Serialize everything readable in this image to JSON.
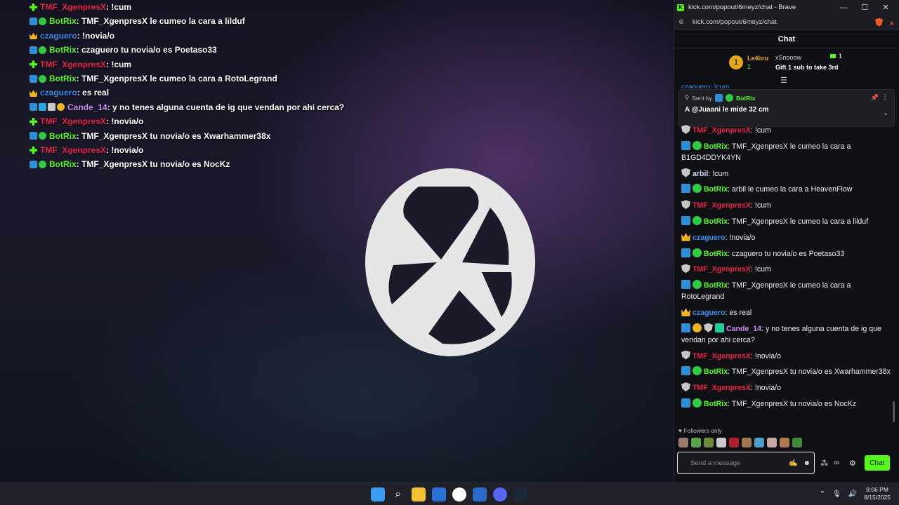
{
  "stream": {
    "overlay_chat": [
      {
        "badges": [
          "plus"
        ],
        "user": "TMF_XgenpresX",
        "user_color": "red",
        "text": ": !cum"
      },
      {
        "badges": [
          "bot",
          "verified"
        ],
        "user": "BotRix",
        "user_color": "green",
        "text": ": TMF_XgenpresX le cumeo la cara a lilduf"
      },
      {
        "badges": [
          "crown"
        ],
        "user": "czaguero",
        "user_color": "blue",
        "text": ": !novia/o"
      },
      {
        "badges": [
          "bot",
          "verified"
        ],
        "user": "BotRix",
        "user_color": "green",
        "text": ": czaguero tu novia/o es Poetaso33"
      },
      {
        "badges": [
          "plus"
        ],
        "user": "TMF_XgenpresX",
        "user_color": "red",
        "text": ": !cum"
      },
      {
        "badges": [
          "bot",
          "verified"
        ],
        "user": "BotRix",
        "user_color": "green",
        "text": ": TMF_XgenpresX le cumeo la cara a RotoLegrand"
      },
      {
        "badges": [
          "crown"
        ],
        "user": "czaguero",
        "user_color": "blue",
        "text": ": es real"
      },
      {
        "badges": [
          "bot",
          "cyan",
          "sub",
          "coin"
        ],
        "user": "Cande_14",
        "user_color": "purple",
        "text": ": y no tenes alguna cuenta de ig que vendan por ahi cerca?"
      },
      {
        "badges": [
          "plus"
        ],
        "user": "TMF_XgenpresX",
        "user_color": "red",
        "text": ": !novia/o"
      },
      {
        "badges": [
          "bot",
          "verified"
        ],
        "user": "BotRix",
        "user_color": "green",
        "text": ": TMF_XgenpresX tu novia/o es Xwarhammer38x"
      },
      {
        "badges": [
          "plus"
        ],
        "user": "TMF_XgenpresX",
        "user_color": "red",
        "text": ": !novia/o"
      },
      {
        "badges": [
          "bot",
          "verified"
        ],
        "user": "BotRix",
        "user_color": "green",
        "text": ": TMF_XgenpresX tu novia/o es NocKz"
      }
    ]
  },
  "popout": {
    "window_title": "kick.com/popout/6meyz/chat - Brave",
    "url": "kick.com/popout/6meyz/chat",
    "chat_header": "Chat",
    "leaderboard": {
      "first_rank": "1",
      "first_user": "Le4bru",
      "first_count": "1",
      "second_user": "xSnooow",
      "second_text": "Gift 1 sub to take 3rd",
      "gift_count": "1"
    },
    "partial_line": "czaguero: !cum",
    "pinned": {
      "sent_by_label": "Sent by",
      "bot_name": "BotRix",
      "text": "A @Juaani le mide 32 cm"
    },
    "messages": [
      {
        "badges": [
          "shield"
        ],
        "user": "TMF_XgenpresX",
        "user_color": "red",
        "text": ": !cum"
      },
      {
        "badges": [
          "bot",
          "verified"
        ],
        "user": "BotRix",
        "user_color": "green",
        "text": ": TMF_XgenpresX le cumeo la cara a B1GD4DDYK4YN"
      },
      {
        "badges": [
          "shield"
        ],
        "user": "arbil",
        "user_color": "light",
        "text": ": !cum"
      },
      {
        "badges": [
          "bot",
          "verified"
        ],
        "user": "BotRix",
        "user_color": "green",
        "text": ": arbil le cumeo la cara a HeavenFlow"
      },
      {
        "badges": [
          "shield"
        ],
        "user": "TMF_XgenpresX",
        "user_color": "red",
        "text": ": !cum"
      },
      {
        "badges": [
          "bot",
          "verified"
        ],
        "user": "BotRix",
        "user_color": "green",
        "text": ": TMF_XgenpresX le cumeo la cara a lilduf"
      },
      {
        "badges": [
          "crown"
        ],
        "user": "czaguero",
        "user_color": "blue",
        "text": ": !novia/o"
      },
      {
        "badges": [
          "bot",
          "verified"
        ],
        "user": "BotRix",
        "user_color": "green",
        "text": ": czaguero tu novia/o es Poetaso33"
      },
      {
        "badges": [
          "shield"
        ],
        "user": "TMF_XgenpresX",
        "user_color": "red",
        "text": ": !cum"
      },
      {
        "badges": [
          "bot",
          "verified"
        ],
        "user": "BotRix",
        "user_color": "green",
        "text": ": TMF_XgenpresX le cumeo la cara a RotoLegrand"
      },
      {
        "badges": [
          "crown"
        ],
        "user": "czaguero",
        "user_color": "blue",
        "text": ": es real"
      },
      {
        "badges": [
          "bot",
          "coin",
          "shield",
          "gift"
        ],
        "user": "Cande_14",
        "user_color": "purple",
        "text": ": y no tenes alguna cuenta de ig que vendan por ahi cerca?"
      },
      {
        "badges": [
          "shield"
        ],
        "user": "TMF_XgenpresX",
        "user_color": "red",
        "text": ": !novia/o"
      },
      {
        "badges": [
          "bot",
          "verified"
        ],
        "user": "BotRix",
        "user_color": "green",
        "text": ": TMF_XgenpresX tu novia/o es Xwarhammer38x"
      },
      {
        "badges": [
          "shield"
        ],
        "user": "TMF_XgenpresX",
        "user_color": "red",
        "text": ": !novia/o"
      },
      {
        "badges": [
          "bot",
          "verified"
        ],
        "user": "BotRix",
        "user_color": "green",
        "text": ": TMF_XgenpresX tu novia/o es NocKz"
      }
    ],
    "followers_only": "Followers only",
    "input_placeholder": "Send a message",
    "send_label": "Chat"
  },
  "taskbar": {
    "time": "8:06 PM",
    "date": "8/15/2025"
  },
  "colors": {
    "kick_green": "#53fc18",
    "user_red": "#e8224a",
    "user_blue": "#3b8df0",
    "user_purple": "#c98cf5"
  }
}
